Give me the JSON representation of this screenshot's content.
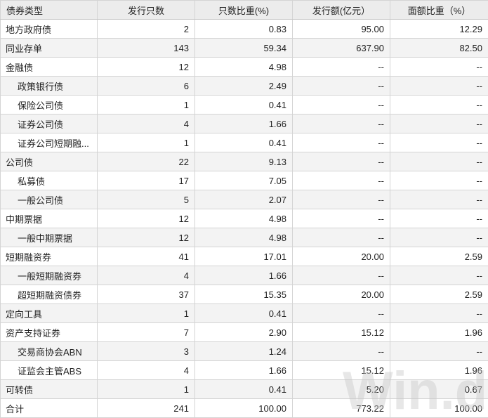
{
  "headers": [
    "债券类型",
    "发行只数",
    "只数比重(%)",
    "发行额(亿元）",
    "面额比重（%）"
  ],
  "rows": [
    {
      "name": "地方政府债",
      "level": 0,
      "count": "2",
      "share": "0.83",
      "amount": "95.00",
      "amount_share": "12.29"
    },
    {
      "name": "同业存单",
      "level": 0,
      "count": "143",
      "share": "59.34",
      "amount": "637.90",
      "amount_share": "82.50"
    },
    {
      "name": "金融债",
      "level": 0,
      "count": "12",
      "share": "4.98",
      "amount": "--",
      "amount_share": "--"
    },
    {
      "name": "政策银行债",
      "level": 1,
      "count": "6",
      "share": "2.49",
      "amount": "--",
      "amount_share": "--"
    },
    {
      "name": "保险公司债",
      "level": 1,
      "count": "1",
      "share": "0.41",
      "amount": "--",
      "amount_share": "--"
    },
    {
      "name": "证券公司债",
      "level": 1,
      "count": "4",
      "share": "1.66",
      "amount": "--",
      "amount_share": "--"
    },
    {
      "name": "证券公司短期融...",
      "level": 1,
      "count": "1",
      "share": "0.41",
      "amount": "--",
      "amount_share": "--"
    },
    {
      "name": "公司债",
      "level": 0,
      "count": "22",
      "share": "9.13",
      "amount": "--",
      "amount_share": "--"
    },
    {
      "name": "私募债",
      "level": 1,
      "count": "17",
      "share": "7.05",
      "amount": "--",
      "amount_share": "--"
    },
    {
      "name": "一般公司债",
      "level": 1,
      "count": "5",
      "share": "2.07",
      "amount": "--",
      "amount_share": "--"
    },
    {
      "name": "中期票据",
      "level": 0,
      "count": "12",
      "share": "4.98",
      "amount": "--",
      "amount_share": "--"
    },
    {
      "name": "一般中期票据",
      "level": 1,
      "count": "12",
      "share": "4.98",
      "amount": "--",
      "amount_share": "--"
    },
    {
      "name": "短期融资券",
      "level": 0,
      "count": "41",
      "share": "17.01",
      "amount": "20.00",
      "amount_share": "2.59"
    },
    {
      "name": "一般短期融资券",
      "level": 1,
      "count": "4",
      "share": "1.66",
      "amount": "--",
      "amount_share": "--"
    },
    {
      "name": "超短期融资债券",
      "level": 1,
      "count": "37",
      "share": "15.35",
      "amount": "20.00",
      "amount_share": "2.59"
    },
    {
      "name": "定向工具",
      "level": 0,
      "count": "1",
      "share": "0.41",
      "amount": "--",
      "amount_share": "--"
    },
    {
      "name": "资产支持证券",
      "level": 0,
      "count": "7",
      "share": "2.90",
      "amount": "15.12",
      "amount_share": "1.96"
    },
    {
      "name": "交易商协会ABN",
      "level": 1,
      "count": "3",
      "share": "1.24",
      "amount": "--",
      "amount_share": "--"
    },
    {
      "name": "证监会主管ABS",
      "level": 1,
      "count": "4",
      "share": "1.66",
      "amount": "15.12",
      "amount_share": "1.96"
    },
    {
      "name": "可转债",
      "level": 0,
      "count": "1",
      "share": "0.41",
      "amount": "5.20",
      "amount_share": "0.67"
    },
    {
      "name": "合计",
      "level": 0,
      "count": "241",
      "share": "100.00",
      "amount": "773.22",
      "amount_share": "100.00",
      "total": true
    }
  ],
  "watermark": {
    "text": "Win.d",
    "color": "#c9c9c9"
  }
}
